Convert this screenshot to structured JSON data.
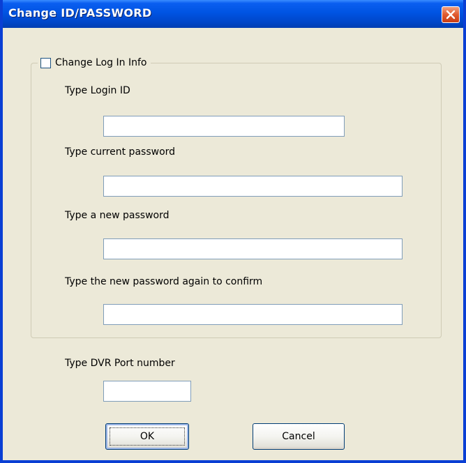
{
  "window": {
    "title": "Change ID/PASSWORD",
    "close_icon": "close-icon"
  },
  "login_group": {
    "checkbox_label": "Change Log In Info",
    "checkbox_checked": false,
    "login_id_label": "Type Login ID",
    "login_id_value": "",
    "current_password_label": "Type current password",
    "current_password_value": "",
    "new_password_label": "Type a new password",
    "new_password_value": "",
    "confirm_password_label": "Type the new password again to confirm",
    "confirm_password_value": ""
  },
  "port": {
    "label": "Type DVR Port number",
    "value": ""
  },
  "buttons": {
    "ok_label": "OK",
    "cancel_label": "Cancel"
  },
  "colors": {
    "titlebar": "#0054e3",
    "dialog_bg": "#ece9d8",
    "close_button": "#e05a30"
  }
}
